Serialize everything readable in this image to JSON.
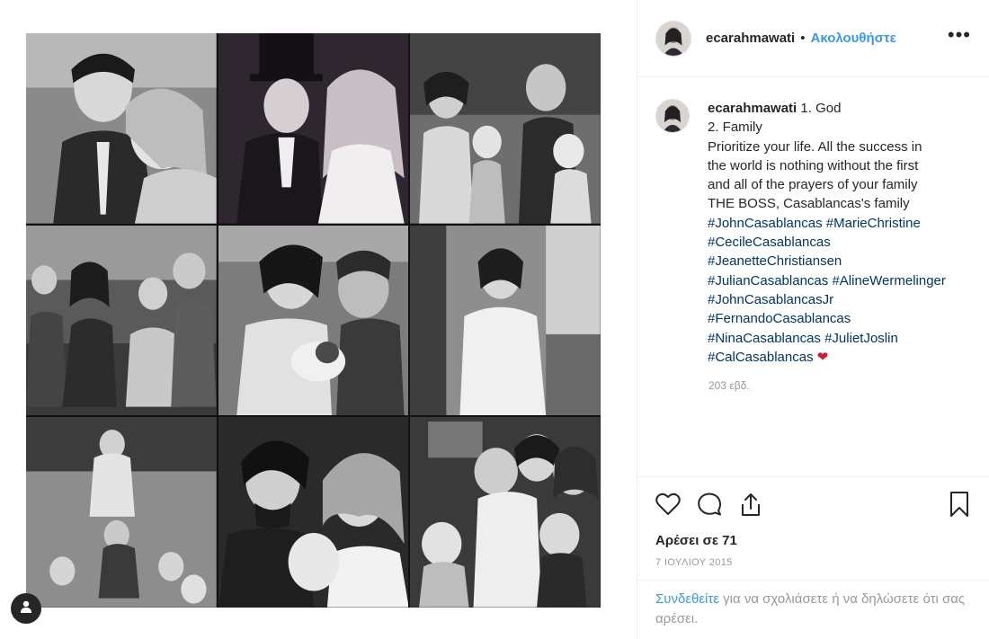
{
  "header": {
    "username": "ecarahmawati",
    "dot": "•",
    "follow_label": "Ακολουθήστε",
    "more_label": "•••"
  },
  "caption": {
    "username": "ecarahmawati",
    "first_line": "1. God",
    "lines": [
      "2. Family",
      "Prioritize your life. All the success in",
      "the world is nothing without the first",
      "and all of the prayers of your family",
      "THE BOSS, Casablancas's family"
    ],
    "hashtag_lines": [
      [
        "#JohnCasablancas",
        "#MarieChristine"
      ],
      [
        "#CecileCasablancas"
      ],
      [
        "#JeanetteChristiansen"
      ],
      [
        "#JulianCasablancas",
        "#AlineWermelinger"
      ],
      [
        "#JohnCasablancasJr"
      ],
      [
        "#FernandoCasablancas"
      ],
      [
        "#NinaCasablancas",
        "#JulietJoslin"
      ],
      [
        "#CalCasablancas"
      ]
    ],
    "heart": "❤",
    "time": "203 εβδ."
  },
  "actions": {
    "likes": "Αρέσει σε 71",
    "date": "7 ΙΟΥΛΙΟΥ 2015"
  },
  "comment": {
    "login_link": "Συνδεθείτε",
    "rest": " για να σχολιάσετε ή να δηλώσετε ότι σας αρέσει."
  },
  "colors": {
    "link_blue": "#3897f0",
    "hashtag_blue": "#003569",
    "heart_red": "#d3192e",
    "muted_gray": "#999999"
  },
  "icons": [
    "heart-icon",
    "comment-icon",
    "share-icon",
    "bookmark-icon",
    "user-tag-icon",
    "more-icon"
  ]
}
